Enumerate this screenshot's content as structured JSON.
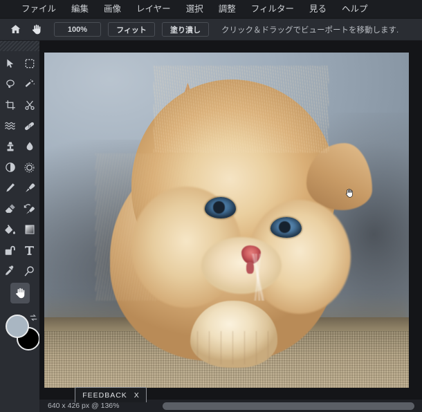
{
  "app": {
    "title": "Pixlr Editor",
    "locale": "ja"
  },
  "menubar": {
    "items": [
      {
        "label": "ファイル",
        "name": "menu-file"
      },
      {
        "label": "編集",
        "name": "menu-edit"
      },
      {
        "label": "画像",
        "name": "menu-image"
      },
      {
        "label": "レイヤー",
        "name": "menu-layer"
      },
      {
        "label": "選択",
        "name": "menu-select"
      },
      {
        "label": "調整",
        "name": "menu-adjustment"
      },
      {
        "label": "フィルター",
        "name": "menu-filter"
      },
      {
        "label": "見る",
        "name": "menu-view"
      },
      {
        "label": "ヘルプ",
        "name": "menu-help"
      }
    ]
  },
  "optionbar": {
    "home_icon": "home-icon",
    "tool_icon": "hand-icon",
    "zoom_100_label": "100%",
    "fit_label": "フィット",
    "fill_label": "塗り潰し",
    "hint": "クリック＆ドラッグでビューポートを移動します."
  },
  "toolpanel": {
    "active_tool": "hand-tool",
    "tools": [
      {
        "label": "移動",
        "icon": "arrow-move-icon"
      },
      {
        "label": "選択範囲",
        "icon": "marquee-select-icon"
      },
      {
        "label": "投げ縄",
        "icon": "lasso-icon"
      },
      {
        "label": "マジックワンド",
        "icon": "magic-wand-icon"
      },
      {
        "label": "切り抜き",
        "icon": "crop-icon"
      },
      {
        "label": "カット",
        "icon": "scissors-icon"
      },
      {
        "label": "ゆがみ",
        "icon": "liquify-icon"
      },
      {
        "label": "傷修復",
        "icon": "heal-bandage-icon"
      },
      {
        "label": "クローンスタンプ",
        "icon": "clone-stamp-icon"
      },
      {
        "label": "ぼかし",
        "icon": "water-drop-icon"
      },
      {
        "label": "覆い焼き",
        "icon": "dodge-burn-icon"
      },
      {
        "label": "シャープ",
        "icon": "sharpen-sun-icon"
      },
      {
        "label": "鉛筆",
        "icon": "pencil-icon"
      },
      {
        "label": "ブラシ",
        "icon": "paintbrush-icon"
      },
      {
        "label": "消しゴム",
        "icon": "eraser-icon"
      },
      {
        "label": "ヒストリーブラシ",
        "icon": "history-brush-icon"
      },
      {
        "label": "塗りつぶし",
        "icon": "paint-bucket-icon"
      },
      {
        "label": "グラデーション",
        "icon": "gradient-icon"
      },
      {
        "label": "図形",
        "icon": "shape-icon"
      },
      {
        "label": "テキスト",
        "icon": "text-t-icon"
      },
      {
        "label": "スポイト",
        "icon": "eyedropper-icon"
      },
      {
        "label": "ズーム",
        "icon": "magnifier-icon"
      }
    ],
    "hand_tool": {
      "label": "手のひら",
      "icon": "hand-icon"
    },
    "swatches": {
      "foreground": "#a9b6c2",
      "background": "#000000",
      "swap_icon": "swap-arrows-icon"
    }
  },
  "canvas": {
    "image_alt": "オレンジ色の子猫",
    "cursor_icon": "hand-cursor-icon"
  },
  "feedback_tab": {
    "label": "FEEDBACK",
    "close_label": "X",
    "close_icon": "close-icon"
  },
  "statusbar": {
    "doc_info": "640 x 426 px @ 136%",
    "scroll_position": 0
  },
  "colors": {
    "menubar_bg": "#1b1d21",
    "panel_bg": "#2a2d33",
    "workspace_bg": "#141518",
    "text": "#cfd2d6",
    "active_tool_bg": "#4c5058"
  }
}
